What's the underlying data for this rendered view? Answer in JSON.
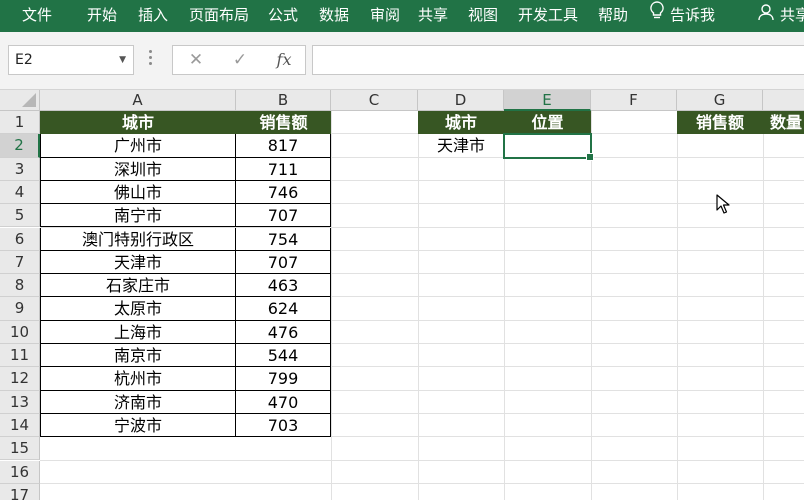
{
  "ribbon": {
    "tabs": [
      "文件",
      "开始",
      "插入",
      "页面布局",
      "公式",
      "数据",
      "审阅",
      "共享",
      "视图",
      "开发工具",
      "帮助"
    ],
    "tell_me": "告诉我",
    "share": "共享"
  },
  "formula_bar": {
    "name_box": "E2",
    "cancel": "✕",
    "enter": "✓",
    "fx": "fx",
    "formula": ""
  },
  "columns": [
    "A",
    "B",
    "C",
    "D",
    "E",
    "F",
    "G"
  ],
  "rows": [
    "1",
    "2",
    "3",
    "4",
    "5",
    "6",
    "7",
    "8",
    "9",
    "10",
    "11",
    "12",
    "13",
    "14",
    "15",
    "16",
    "17"
  ],
  "table1": {
    "header": [
      "城市",
      "销售额"
    ],
    "rows": [
      [
        "广州市",
        "817"
      ],
      [
        "深圳市",
        "711"
      ],
      [
        "佛山市",
        "746"
      ],
      [
        "南宁市",
        "707"
      ],
      [
        "澳门特别行政区",
        "754"
      ],
      [
        "天津市",
        "707"
      ],
      [
        "石家庄市",
        "463"
      ],
      [
        "太原市",
        "624"
      ],
      [
        "上海市",
        "476"
      ],
      [
        "南京市",
        "544"
      ],
      [
        "杭州市",
        "799"
      ],
      [
        "济南市",
        "470"
      ],
      [
        "宁波市",
        "703"
      ]
    ]
  },
  "table2": {
    "header": [
      "城市",
      "位置",
      "",
      "销售额",
      "数量"
    ],
    "row2_city": "天津市"
  },
  "colors": {
    "ribbon": "#217346",
    "header_fill": "#375623",
    "selection": "#217346"
  }
}
